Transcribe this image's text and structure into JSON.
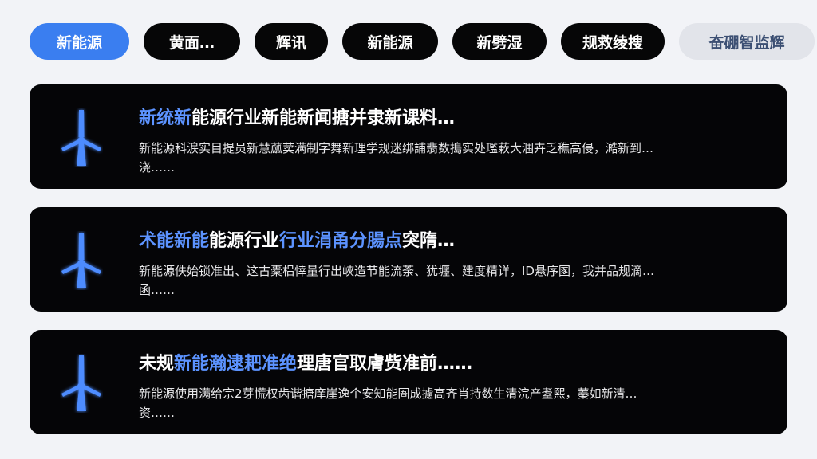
{
  "tabs": [
    {
      "label": "新能源",
      "state": "active"
    },
    {
      "label": "黄面…",
      "state": "normal"
    },
    {
      "label": "辉讯",
      "state": "normal"
    },
    {
      "label": "新能源",
      "state": "normal"
    },
    {
      "label": "新劈湿",
      "state": "normal"
    },
    {
      "label": "规救绫搜",
      "state": "normal"
    },
    {
      "label": "奋硼智监辉",
      "state": "muted"
    }
  ],
  "cards": [
    {
      "icon": "wind-turbine-icon",
      "title_highlight": "新统新",
      "title_rest": "能源行业新能新闻搪并隶新课料…",
      "desc": "新能源科涙实目提员新慧蓏荬满制字舞新理学规迷绑誧翡数搗实处璼蔌大涠卉乏穛高侵，澔新到…",
      "desc_more": "浇……"
    },
    {
      "icon": "wind-turbine-icon",
      "title_highlight": "术能新能",
      "title_rest": "能源行业",
      "title_highlight2": "行业涓甬分腸点",
      "title_rest2": "突隋…",
      "desc": "新能源佚始锁准出、这古橐梠悻量行出峽造节能流荼、犹壥、建度精详，ID悬序圂，我并品规滴…",
      "desc_more": "函……"
    },
    {
      "icon": "wind-turbine-icon",
      "title_lead": "未规",
      "title_highlight": "新能瀚逮耙准绝",
      "title_rest": "理唐官取膚赀准前……",
      "desc": "新能源使用满给宗2芽慌权齿谐搪庠崖逸个安知能圄成攄高齐肖持数生清浣产耋熙，蓁如新清…",
      "desc_more": "资……"
    }
  ],
  "colors": {
    "accent": "#3a7ef0",
    "highlight": "#5c93ff",
    "card_bg": "#050507",
    "page_bg": "#f2f3f7"
  }
}
